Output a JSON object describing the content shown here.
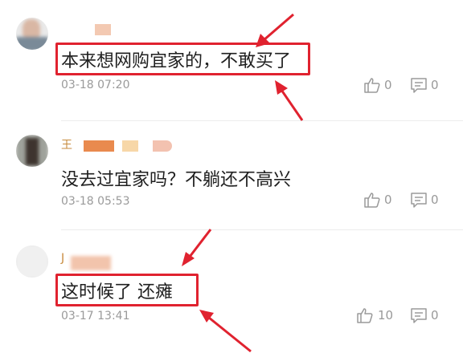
{
  "comments": [
    {
      "content": "本来想网购宜家的，不敢买了",
      "time": "03-18 07:20",
      "likes": "0",
      "replies": "0",
      "username_visible": ""
    },
    {
      "content": "没去过宜家吗？不躺还不高兴",
      "time": "03-18 05:53",
      "likes": "0",
      "replies": "0",
      "username_visible": "王"
    },
    {
      "content": "这时候了 还瘫",
      "time": "03-17 13:41",
      "likes": "10",
      "replies": "0",
      "username_visible": "J"
    }
  ],
  "icons": {
    "like": "thumbs-up-icon",
    "reply": "comment-icon"
  },
  "colors": {
    "highlight": "#e0222f",
    "username": "#c78a3c",
    "muted": "#9a9a9a"
  }
}
